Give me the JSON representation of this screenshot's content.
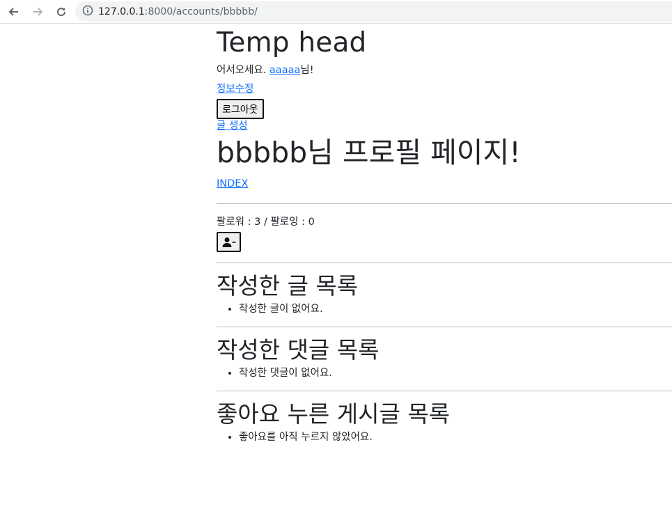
{
  "browser": {
    "url_host": "127.0.0.1",
    "url_rest": ":8000/accounts/bbbbb/"
  },
  "header": {
    "title": "Temp head",
    "welcome_prefix": "어서오세요. ",
    "username": "aaaaa",
    "welcome_suffix": "님!",
    "edit_link": "정보수정",
    "logout_button": "로그아웃",
    "create_link": "글 생성"
  },
  "profile": {
    "title": "bbbbb님 프로필 페이지!",
    "index_link": "INDEX",
    "follow_text": "팔로워 : 3 / 팔로잉 : 0",
    "follow_button_icon": "user-minus-icon"
  },
  "sections": {
    "posts": {
      "title": "작성한 글 목록",
      "empty": "작성한 글이 없어요."
    },
    "comments": {
      "title": "작성한 댓글 목록",
      "empty": "작성한 댓글이 없어요."
    },
    "likes": {
      "title": "좋아요 누른 게시글 목록",
      "empty": "좋아요를 아직 누르지 않았어요."
    }
  }
}
